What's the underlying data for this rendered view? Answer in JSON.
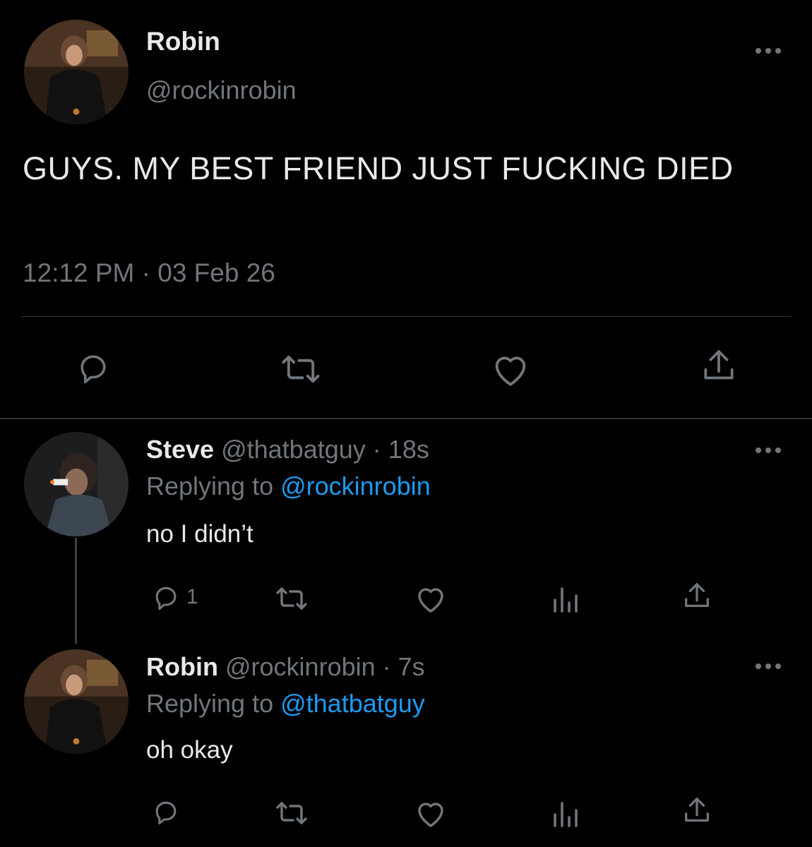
{
  "main_tweet": {
    "name": "Robin",
    "handle": "@rockinrobin",
    "text": "GUYS. MY BEST FRIEND JUST FUCKING DIED",
    "timestamp": "12:12 PM · 03 Feb 26"
  },
  "replies": [
    {
      "name": "Steve",
      "handle": "@thatbatguy",
      "time": "18s",
      "replying_to_prefix": "Replying to ",
      "replying_to": "@rockinrobin",
      "text": "no I didn’t",
      "reply_count": "1"
    },
    {
      "name": "Robin",
      "handle": "@rockinrobin",
      "time": "7s",
      "replying_to_prefix": "Replying to ",
      "replying_to": "@thatbatguy",
      "text": "oh okay",
      "reply_count": ""
    }
  ],
  "icons": [
    "reply-icon",
    "retweet-icon",
    "like-icon",
    "share-icon",
    "analytics-icon",
    "more-icon"
  ],
  "colors": {
    "background": "#000000",
    "text": "#e7e9ea",
    "muted": "#71767b",
    "link": "#1d9bf0",
    "divider": "#2f3336"
  }
}
